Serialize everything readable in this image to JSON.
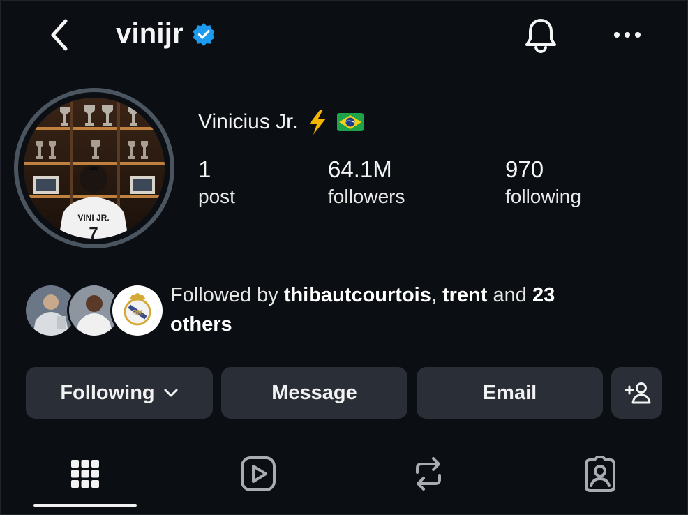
{
  "header": {
    "username": "vinijr",
    "verified": true,
    "icons": [
      "chevron-left-icon",
      "verified-badge-icon",
      "bell-icon",
      "more-horizontal-icon"
    ]
  },
  "profile": {
    "display_name": "Vinicius Jr.",
    "name_emojis": [
      "⚡",
      "🇧🇷"
    ],
    "avatar_jersey_text": "VINI JR.",
    "avatar_jersey_number": "7",
    "stats": [
      {
        "value": "1",
        "label": "post"
      },
      {
        "value": "64.1M",
        "label": "followers"
      },
      {
        "value": "970",
        "label": "following"
      }
    ]
  },
  "followed_by": {
    "prefix": "Followed by ",
    "user1": "thibautcourtois",
    "sep1": ", ",
    "user2": "trent",
    "mid": " and ",
    "count": "23",
    "line2": "others"
  },
  "actions": {
    "following_label": "Following",
    "message_label": "Message",
    "email_label": "Email",
    "add_user_icon": "add-user-icon"
  },
  "tabs": [
    {
      "name": "grid",
      "icon": "grid-icon",
      "active": true
    },
    {
      "name": "reels",
      "icon": "reels-icon",
      "active": false
    },
    {
      "name": "reposts",
      "icon": "repost-icon",
      "active": false
    },
    {
      "name": "tagged",
      "icon": "tagged-icon",
      "active": false
    }
  ],
  "colors": {
    "background": "#0b0f14",
    "button_bg": "#2a2f37",
    "verified_blue": "#1d9bf0",
    "text": "#f5f5f5"
  }
}
